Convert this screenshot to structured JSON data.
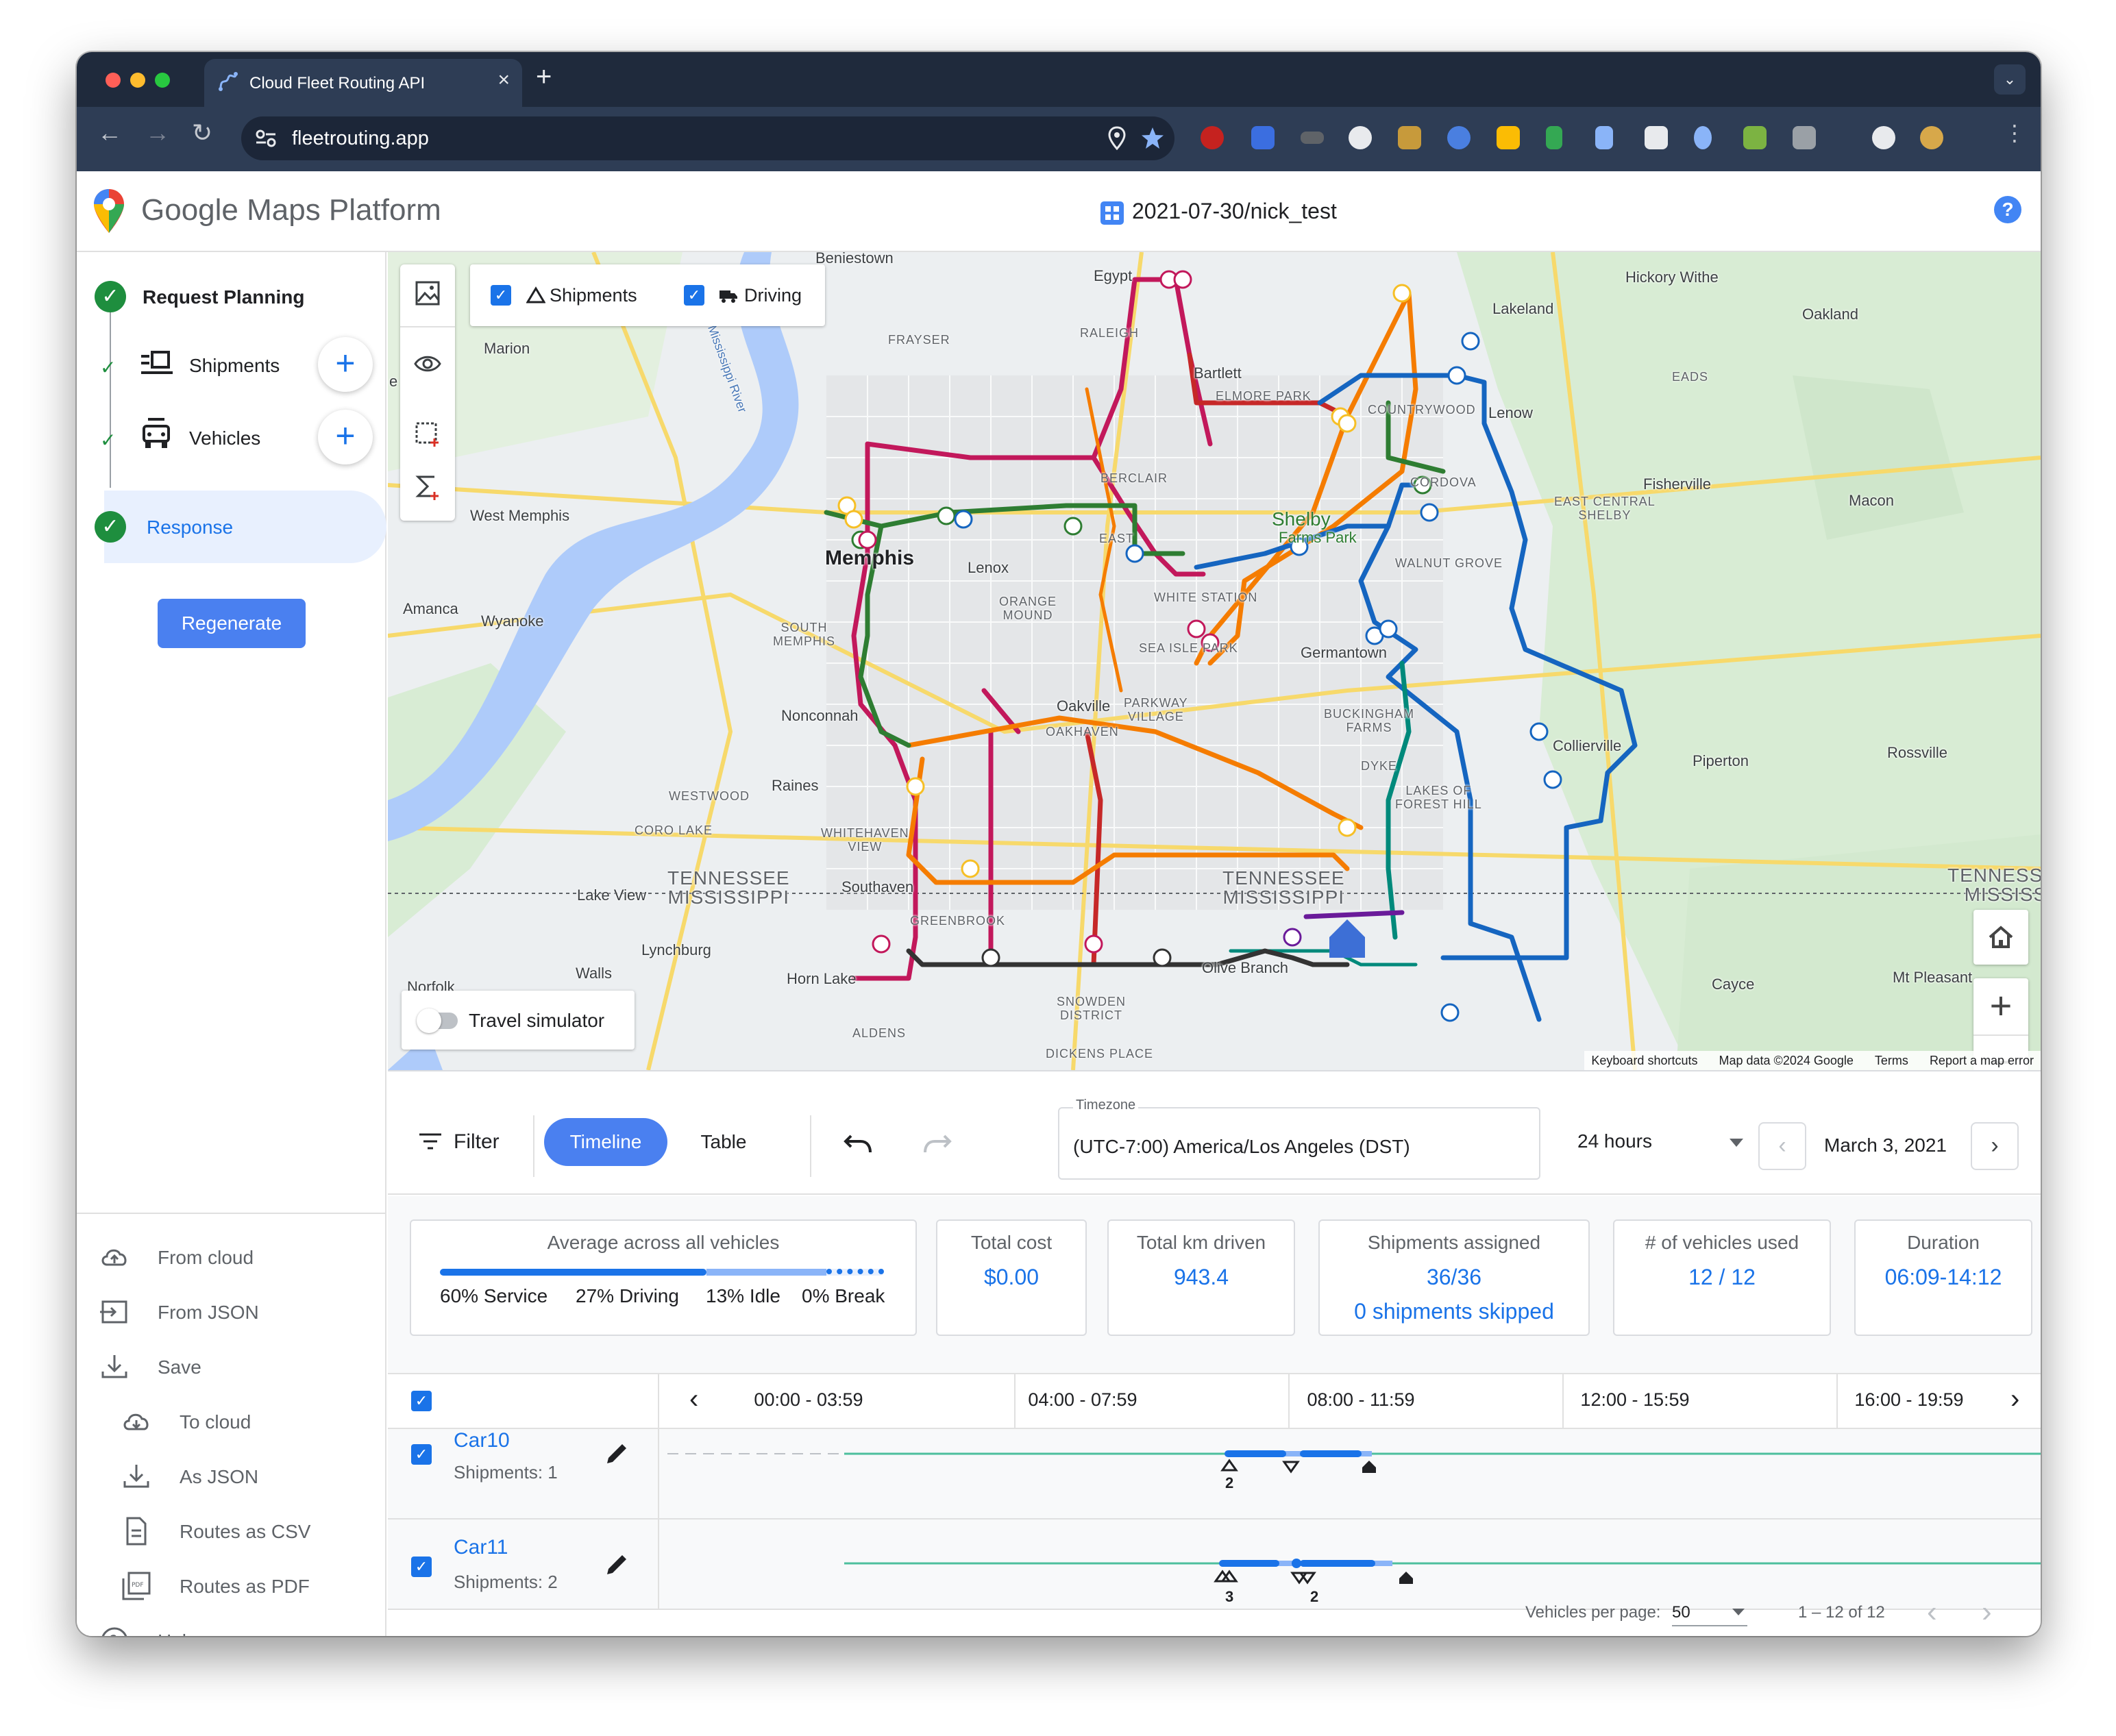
{
  "browser": {
    "tab_title": "Cloud Fleet Routing API",
    "url": "fleetrouting.app",
    "tab_close_icon": "×",
    "new_tab_icon": "+",
    "tab_menu_icon": "⌄"
  },
  "header": {
    "brand": "Google Maps Platform",
    "project": "2021-07-30/nick_test",
    "help": "?"
  },
  "sidebar": {
    "steps": [
      {
        "label": "Request Planning"
      },
      {
        "label": "Shipments"
      },
      {
        "label": "Vehicles"
      },
      {
        "label": "Response"
      }
    ],
    "add_icon": "+",
    "regenerate": "Regenerate",
    "actions": {
      "from_cloud": "From cloud",
      "from_json": "From JSON",
      "save": "Save",
      "to_cloud": "To cloud",
      "as_json": "As JSON",
      "routes_csv": "Routes as CSV",
      "routes_pdf": "Routes as PDF",
      "help": "Help"
    }
  },
  "map": {
    "layers": {
      "shipments": "Shipments",
      "driving": "Driving",
      "checkmark": "✓"
    },
    "travel_simulator": "Travel simulator",
    "zoom_in": "+",
    "zoom_out": "−",
    "attribution": {
      "keyboard": "Keyboard shortcuts",
      "data": "Map data ©2024 Google",
      "terms": "Terms",
      "report": "Report a map error"
    },
    "places": {
      "memphis": "Memphis",
      "egypt": "Egypt",
      "beniestown": "Beniestown",
      "frayser": "FRAYSER",
      "raleigh": "RALEIGH",
      "bartlett": "Bartlett",
      "elmore_park": "ELMORE PARK",
      "lakeland": "Lakeland",
      "hickory_withe": "Hickory Withe",
      "oakland": "Oakland",
      "eads": "EADS",
      "marion": "Marion",
      "e_spur": "e Spur",
      "mississippi_river": "Mississippi River",
      "countrywood": "COUNTRYWOOD",
      "lenow": "Lenow",
      "berclair": "BERCLAIR",
      "cordova": "CORDOVA",
      "fisherville": "Fisherville",
      "east_central_shelby": "EAST CENTRAL\nSHELBY",
      "macon": "Macon",
      "west_memphis": "West Memphis",
      "shelby": "Shelby",
      "shelby_farms": "Farms Park",
      "east": "EAST",
      "walnut_grove": "WALNUT GROVE",
      "lenox": "Lenox",
      "white_station": "WHITE STATION",
      "amanca": "Amanca",
      "wyanoke": "Wyanoke",
      "orange_mound": "ORANGE\nMOUND",
      "south_memphis": "SOUTH\nMEMPHIS",
      "sea_isle_park": "SEA ISLE PARK",
      "germantown": "Germantown",
      "nonconnah": "Nonconnah",
      "oakville": "Oakville",
      "parkway_village": "PARKWAY\nVILLAGE",
      "oakhaven": "OAKHAVEN",
      "buckingham_farms": "BUCKINGHAM\nFARMS",
      "collierville": "Collierville",
      "piperton": "Piperton",
      "rossville": "Rossville",
      "raines": "Raines",
      "westwood": "WESTWOOD",
      "dykel": "DYKE",
      "lakes_forest_hill": "LAKES OF\nFOREST HILL",
      "coro_lake": "CORO LAKE",
      "whitehaven_view": "WHITEHAVEN\nVIEW",
      "tn_ms_left": "TENNESSEE\nMISSISSIPPI",
      "tn_ms_mid": "TENNESSEE\nMISSISSIPPI",
      "tn_ms_right": "TENNESSEE\nMISSISSI",
      "lake_view": "Lake View",
      "southaven": "Southaven",
      "greenbrook": "GREENBROOK",
      "lynchburg": "Lynchburg",
      "horn_lake": "Horn Lake",
      "walls": "Walls",
      "norfolk": "Norfolk",
      "olive_branch": "Olive Branch",
      "snowden_district": "SNOWDEN\nDISTRICT",
      "aldens": "ALDENS",
      "dickens_place": "DICKENS PLACE",
      "cayce": "Cayce",
      "mt_pleasant": "Mt Pleasant"
    }
  },
  "controls": {
    "filter": "Filter",
    "timeline": "Timeline",
    "table": "Table",
    "timezone_label": "Timezone",
    "timezone": "(UTC-7:00) America/Los Angeles (DST)",
    "range": "24 hours",
    "date": "March 3, 2021",
    "prev": "‹",
    "next": "›"
  },
  "stats": {
    "average_title": "Average across all vehicles",
    "service": "60% Service",
    "driving": "27% Driving",
    "idle": "13% Idle",
    "break": "0% Break",
    "service_pct": 60,
    "driving_pct": 27,
    "idle_pct": 13,
    "total_cost_title": "Total cost",
    "total_cost": "$0.00",
    "km_title": "Total km driven",
    "km": "943.4",
    "shipments_title": "Shipments assigned",
    "shipments": "36/36",
    "skipped": "0 shipments skipped",
    "vehicles_title": "# of vehicles used",
    "vehicles": "12 / 12",
    "duration_title": "Duration",
    "duration": "06:09-14:12"
  },
  "timeline": {
    "columns": [
      "00:00 - 03:59",
      "04:00 - 07:59",
      "08:00 - 11:59",
      "12:00 - 15:59",
      "16:00 - 19:59"
    ],
    "prev": "‹",
    "next": "›",
    "vehicles": [
      {
        "name": "Car10",
        "shipments": "Shipments: 1",
        "pickup_count": "2",
        "delivery_count": ""
      },
      {
        "name": "Car11",
        "shipments": "Shipments: 2",
        "pickup_count": "3",
        "delivery_count": "2"
      }
    ]
  },
  "pagination": {
    "per_page_label": "Vehicles per page:",
    "per_page": "50",
    "range": "1 – 12 of 12"
  },
  "colors": {
    "accent": "#1a73e8",
    "route_red": "#c2185b",
    "route_orange": "#f57c00",
    "route_green": "#2e7d32",
    "route_blue": "#1565c0",
    "route_teal": "#00897b",
    "route_dark": "#333333",
    "route_purple": "#6a1b9a",
    "route_darkred": "#c62828",
    "route_yellow": "#f6bf26"
  }
}
